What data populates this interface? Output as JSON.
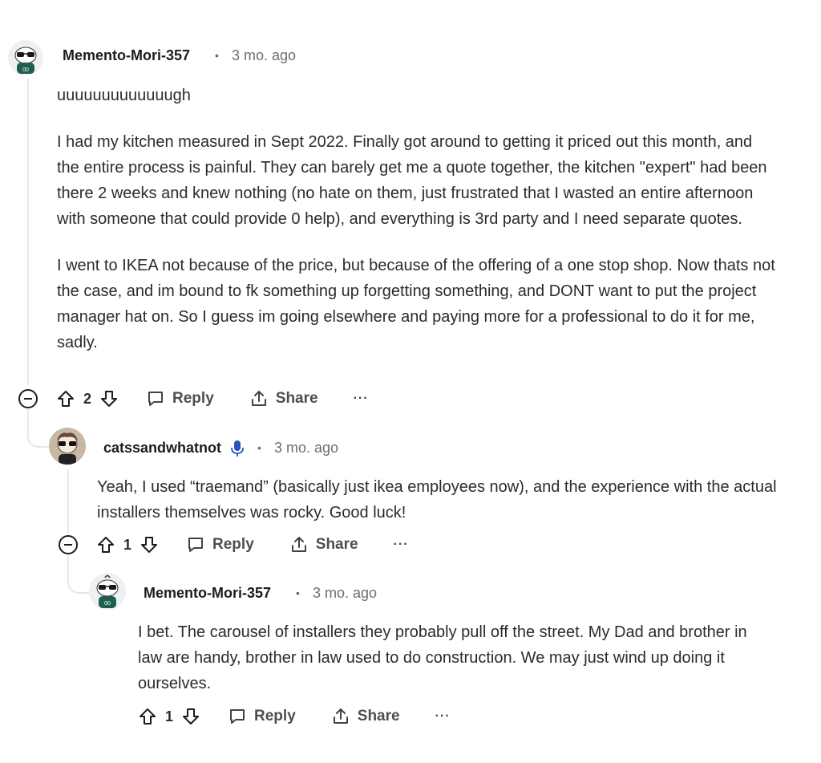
{
  "comments": [
    {
      "author": "Memento-Mori-357",
      "separator": "•",
      "time": "3 mo. ago",
      "paragraphs": [
        "uuuuuuuuuuuuugh",
        "I had my kitchen measured in Sept 2022. Finally got around to getting it priced out this month, and the entire process is painful. They can barely get me a quote together, the kitchen \"expert\" had been there 2 weeks and knew nothing (no hate on them, just frustrated that I wasted an entire afternoon with someone that could provide 0 help), and everything is 3rd party and I need separate quotes.",
        "I went to IKEA not because of the price, but because of the offering of a one stop shop. Now thats not the case, and im bound to fk something up forgetting something, and DONT want to put the project manager hat on. So I guess im going elsewhere and paying more for a professional to do it for me, sadly."
      ],
      "votes": "2",
      "reply_label": "Reply",
      "share_label": "Share",
      "more_label": "···"
    },
    {
      "author": "catssandwhatnot",
      "separator": "•",
      "time": "3 mo. ago",
      "paragraphs": [
        "Yeah, I used “traemand” (basically just ikea employees now), and the experience with the actual installers themselves was rocky. Good luck!"
      ],
      "votes": "1",
      "reply_label": "Reply",
      "share_label": "Share",
      "more_label": "···"
    },
    {
      "author": "Memento-Mori-357",
      "separator": "•",
      "time": "3 mo. ago",
      "paragraphs": [
        "I bet. The carousel of installers they probably pull off the street. My Dad and brother in law are handy, brother in law used to do construction. We may just wind up doing it ourselves."
      ],
      "votes": "1",
      "reply_label": "Reply",
      "share_label": "Share",
      "more_label": "···"
    }
  ],
  "colors": {
    "thread_line": "#e5e7e9",
    "mic_badge": "#2a52be",
    "meta_text": "#6a6e73"
  }
}
